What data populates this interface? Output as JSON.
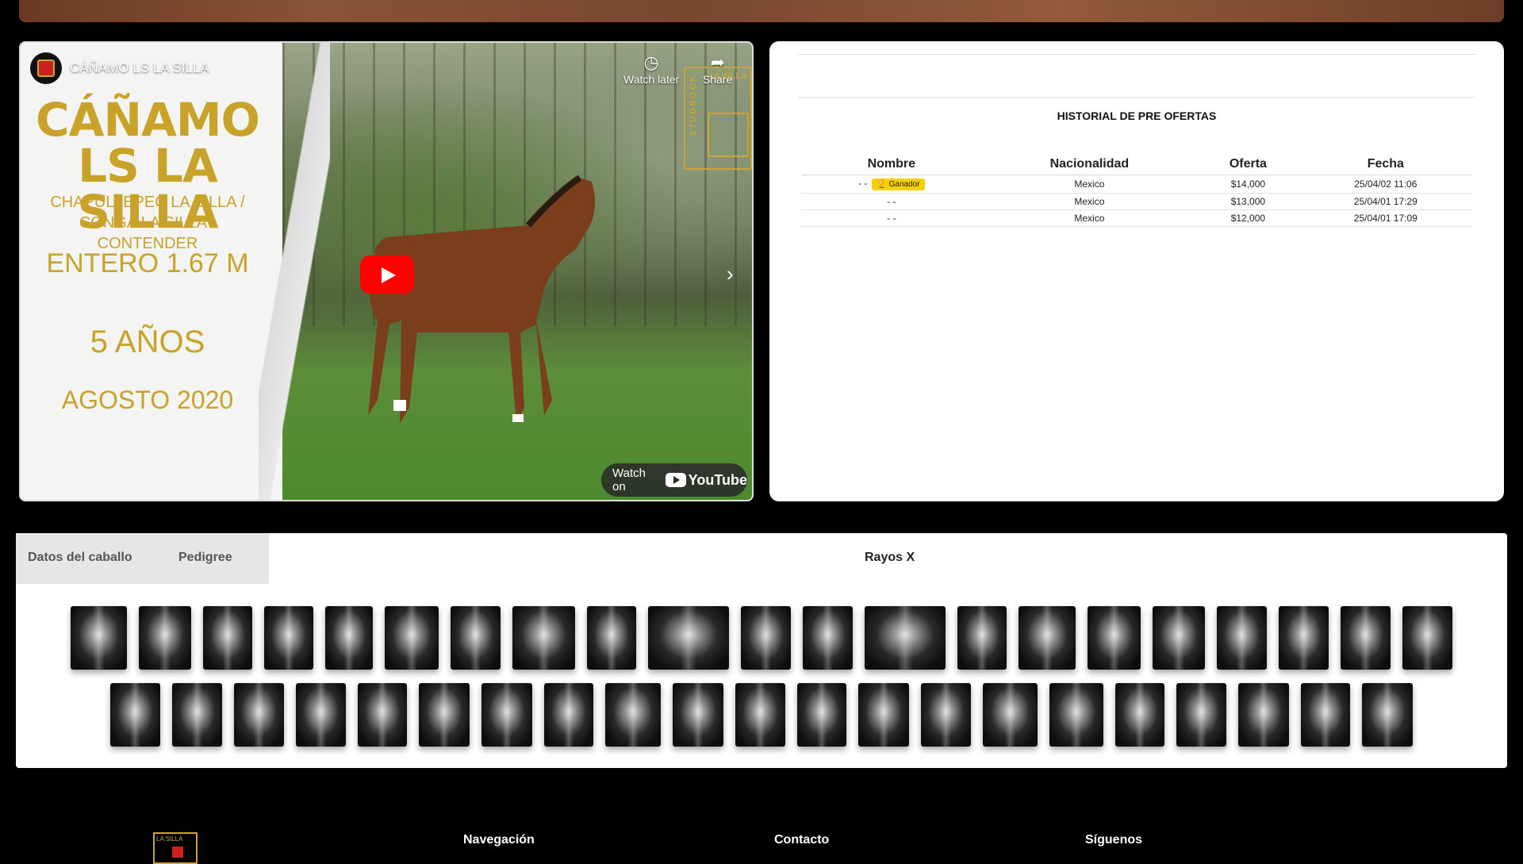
{
  "video": {
    "channel_title": "CÁÑAMO LS LA SILLA",
    "watch_later": "Watch later",
    "share": "Share",
    "watch_on": "Watch on",
    "youtube": "YouTube",
    "overlay": {
      "name": "CÁÑAMO LS LA SILLA",
      "parents": "CHAPULTEPEC LA SILLA / CONGA LA SILLA - CONTENDER",
      "sex_height": "ENTERO 1.67 M",
      "age": "5 AÑOS",
      "date": "AGOSTO 2020"
    },
    "logo_vertical": "STUDBOOK",
    "logo_horizontal": "LA SILLA"
  },
  "offers": {
    "title": "HISTORIAL DE PRE OFERTAS",
    "columns": [
      "Nombre",
      "Nacionalidad",
      "Oferta",
      "Fecha"
    ],
    "rows": [
      {
        "name": "- -",
        "badge": "Ganador",
        "nationality": "Mexico",
        "offer": "$14,000",
        "date": "25/04/02 11:06"
      },
      {
        "name": "- -",
        "badge": "",
        "nationality": "Mexico",
        "offer": "$13,000",
        "date": "25/04/01 17:29"
      },
      {
        "name": "- -",
        "badge": "",
        "nationality": "Mexico",
        "offer": "$12,000",
        "date": "25/04/01 17:09"
      }
    ]
  },
  "tabs": {
    "datos": "Datos del caballo",
    "pedigree": "Pedigree",
    "rayos": "Rayos X"
  },
  "footer": {
    "nav": "Navegación",
    "contact": "Contacto",
    "follow": "Síguenos",
    "logo_text": "LA SILLA"
  }
}
